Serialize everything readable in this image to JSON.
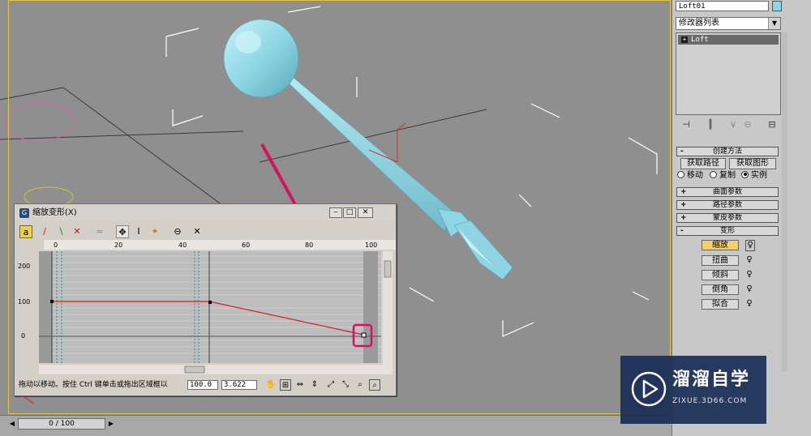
{
  "command_panel": {
    "object_name": "Loft01",
    "object_color": "#8ed7e6",
    "modifier_list": "修改器列表",
    "stack_item": "Loft",
    "creation_rollout": "创建方法",
    "get_path": "获取路径",
    "get_shape": "获取图形",
    "radio_options": [
      "移动",
      "复制",
      "实例"
    ],
    "radio_selected": "实例",
    "rollouts": [
      "曲面参数",
      "路径参数",
      "蒙皮参数"
    ],
    "deform_rollout": "变形",
    "deform_buttons": [
      "缩放",
      "扭曲",
      "倾斜",
      "倒角",
      "拟合"
    ],
    "deform_active": "缩放"
  },
  "dialog": {
    "title": "缩放变形(X)",
    "status_text": "拖动以移动。按住 Ctrl 键单击或拖出区域框以",
    "x_value": "100.0",
    "y_value": "3.622",
    "ruler_labels": [
      "0",
      "20",
      "40",
      "60",
      "80",
      "100"
    ],
    "y_labels": [
      "200",
      "100",
      "0"
    ]
  },
  "timeline": {
    "frame_label": "0 / 100"
  },
  "watermark": {
    "title": "溜溜自学",
    "subtitle": "ZIXUE.3D66.COM"
  },
  "colors": {
    "viewport_bg": "#8f8f8f",
    "nail": "#8ed7e6",
    "curve": "#d02020",
    "annotation": "#d4145a",
    "active_button": "#f2d264"
  }
}
